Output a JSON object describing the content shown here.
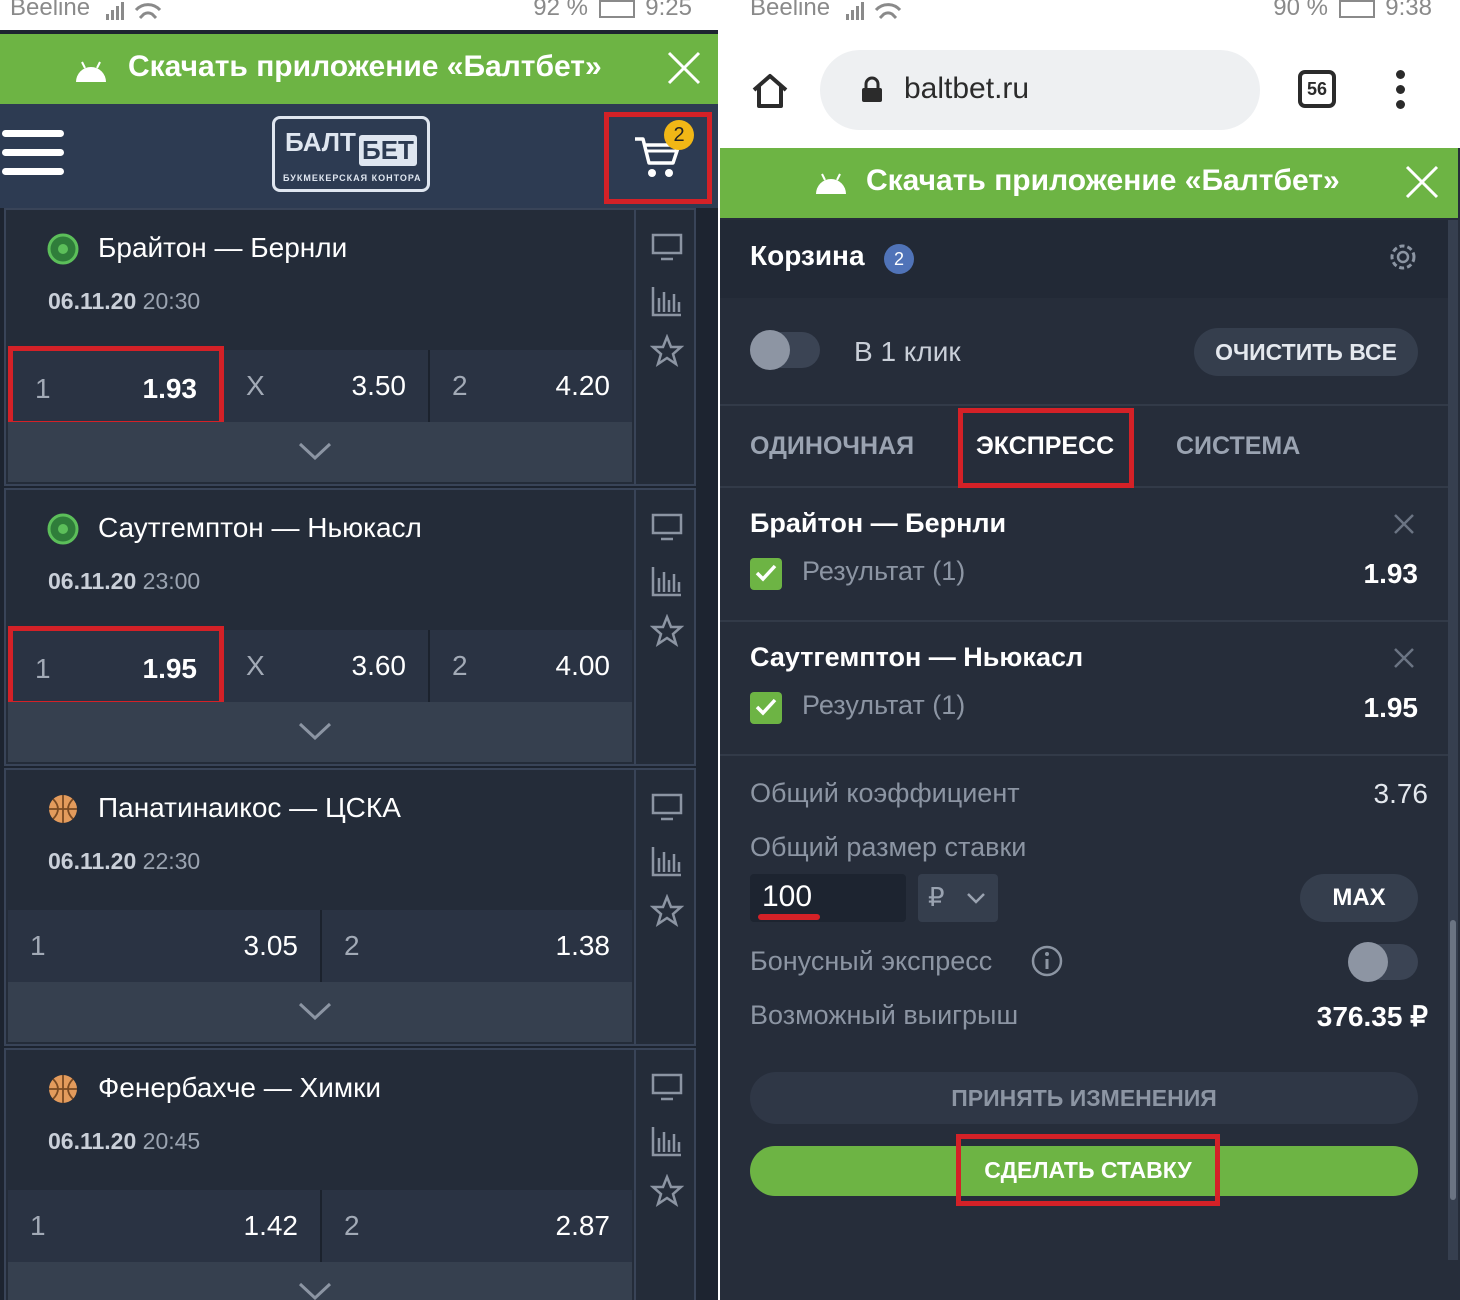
{
  "left_screen": {
    "status": {
      "carrier": "Beeline",
      "battery": "92 %",
      "time": "9:25"
    },
    "banner": {
      "text": "Скачать приложение «Балтбет»"
    },
    "logo": {
      "word1": "БАЛТ",
      "word2": "БЕТ",
      "tagline": "БУКМЕКЕРСКАЯ КОНТОРА"
    },
    "cart_count": "2",
    "matches": [
      {
        "title": "Брайтон — Бернли",
        "date": "06.11.20",
        "time": "20:30",
        "sport": "football",
        "odds": [
          {
            "label": "1",
            "value": "1.93"
          },
          {
            "label": "X",
            "value": "3.50"
          },
          {
            "label": "2",
            "value": "4.20"
          }
        ]
      },
      {
        "title": "Саутгемптон — Ньюкасл",
        "date": "06.11.20",
        "time": "23:00",
        "sport": "football",
        "odds": [
          {
            "label": "1",
            "value": "1.95"
          },
          {
            "label": "X",
            "value": "3.60"
          },
          {
            "label": "2",
            "value": "4.00"
          }
        ]
      },
      {
        "title": "Панатинаикос — ЦСКА",
        "date": "06.11.20",
        "time": "22:30",
        "sport": "basketball",
        "odds": [
          {
            "label": "1",
            "value": "3.05"
          },
          {
            "label": "2",
            "value": "1.38"
          }
        ]
      },
      {
        "title": "Фенербахче — Химки",
        "date": "06.11.20",
        "time": "20:45",
        "sport": "basketball",
        "odds": [
          {
            "label": "1",
            "value": "1.42"
          },
          {
            "label": "2",
            "value": "2.87"
          }
        ]
      }
    ]
  },
  "right_screen": {
    "status": {
      "carrier": "Beeline",
      "battery": "90 %",
      "time": "9:38"
    },
    "browser": {
      "url": "baltbet.ru",
      "tab_count": "56"
    },
    "banner": {
      "text": "Скачать приложение «Балтбет»"
    },
    "cart": {
      "title": "Корзина",
      "count": "2",
      "one_click_label": "В 1 клик",
      "clear_all": "ОЧИСТИТЬ ВСЕ",
      "tabs": [
        {
          "label": "ОДИНОЧНАЯ"
        },
        {
          "label": "ЭКСПРЕСС"
        },
        {
          "label": "СИСТЕМА"
        }
      ],
      "active_tab": "ЭКСПРЕСС",
      "bets": [
        {
          "match": "Брайтон — Бернли",
          "market": "Результат (1)",
          "odd": "1.93"
        },
        {
          "match": "Саутгемптон — Ньюкасл",
          "market": "Результат (1)",
          "odd": "1.95"
        }
      ],
      "total_coef_label": "Общий коэффициент",
      "total_coef": "3.76",
      "stake_label": "Общий размер ставки",
      "stake": "100",
      "currency": "₽",
      "max_label": "MAX",
      "bonus_label": "Бонусный экспресс",
      "win_label": "Возможный выигрыш",
      "win_value": "376.35 ₽",
      "accept_label": "ПРИНЯТЬ ИЗМЕНЕНИЯ",
      "place_bet_label": "СДЕЛАТЬ СТАВКУ"
    }
  },
  "colors": {
    "accent_green": "#6db444",
    "highlight_red": "#d42127",
    "badge_yellow": "#f1b716",
    "badge_blue": "#5073b8"
  }
}
